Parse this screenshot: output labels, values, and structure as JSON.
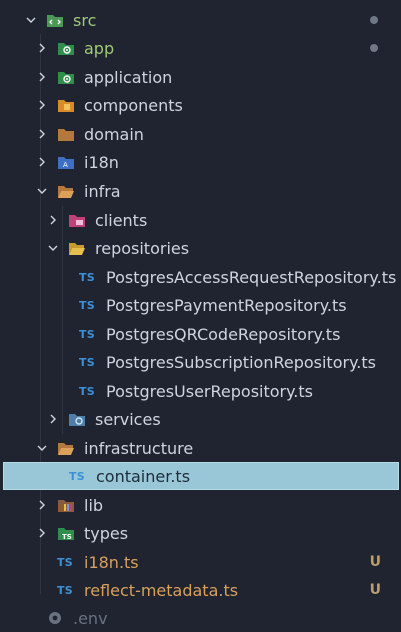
{
  "explorer": {
    "items": [
      {
        "label": "src",
        "status": "dot"
      },
      {
        "label": "app",
        "status": "dot"
      },
      {
        "label": "application"
      },
      {
        "label": "components"
      },
      {
        "label": "domain"
      },
      {
        "label": "i18n"
      },
      {
        "label": "infra"
      },
      {
        "label": "clients"
      },
      {
        "label": "repositories"
      },
      {
        "label": "PostgresAccessRequestRepository.ts",
        "badge": "TS"
      },
      {
        "label": "PostgresPaymentRepository.ts",
        "badge": "TS"
      },
      {
        "label": "PostgresQRCodeRepository.ts",
        "badge": "TS"
      },
      {
        "label": "PostgresSubscriptionRepository.ts",
        "badge": "TS"
      },
      {
        "label": "PostgresUserRepository.ts",
        "badge": "TS"
      },
      {
        "label": "services"
      },
      {
        "label": "infrastructure"
      },
      {
        "label": "container.ts",
        "badge": "TS",
        "selected": true
      },
      {
        "label": "lib"
      },
      {
        "label": "types"
      },
      {
        "label": "i18n.ts",
        "badge": "TS",
        "status": "U"
      },
      {
        "label": "reflect-metadata.ts",
        "badge": "TS",
        "status": "U"
      },
      {
        "label": ".env"
      }
    ]
  },
  "colors": {
    "background": "#1f2430",
    "selected_bg": "#99c7d8",
    "ts_badge": "#3f8fd6",
    "untracked": "#b89e6a",
    "green_text": "#9fc977",
    "orange_text": "#d9a15a"
  }
}
